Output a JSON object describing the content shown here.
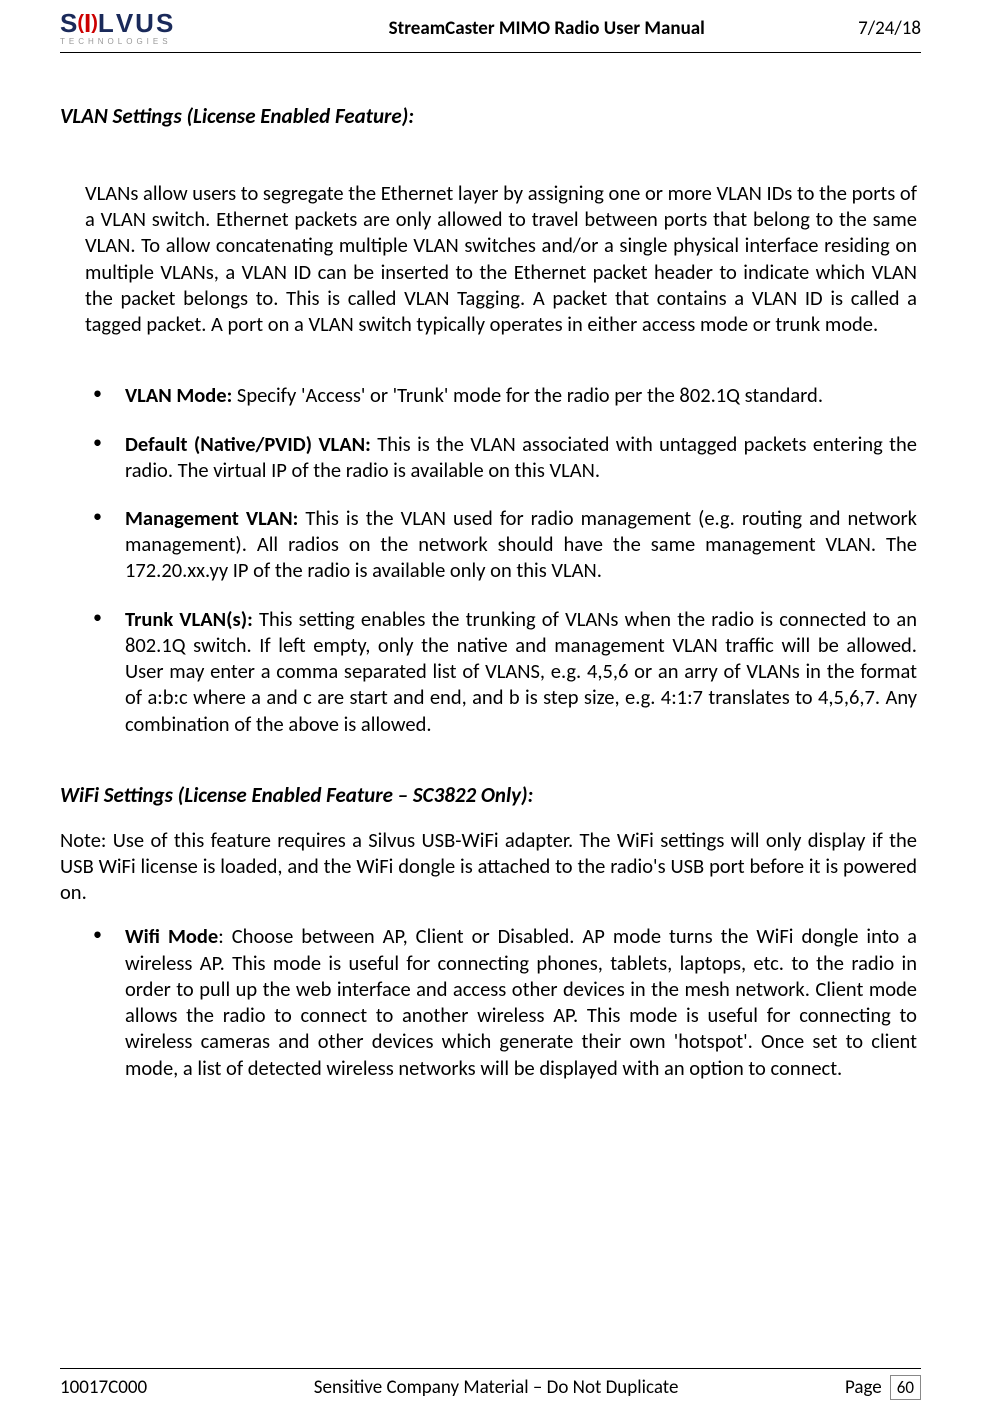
{
  "header": {
    "logo_main": "SILVUS",
    "logo_sub": "TECHNOLOGIES",
    "title": "StreamCaster MIMO Radio User Manual",
    "date": "7/24/18"
  },
  "section1": {
    "title": "VLAN Settings (License Enabled Feature):",
    "intro": "VLANs allow users to segregate the Ethernet layer by assigning one or more VLAN IDs to the ports of a VLAN switch. Ethernet packets are only allowed to travel between ports that belong to the same VLAN. To allow concatenating multiple VLAN switches and/or a single physical interface residing on multiple VLANs, a VLAN ID can be inserted to the Ethernet packet header to indicate which VLAN the packet belongs to. This is called VLAN Tagging. A packet that contains a VLAN ID is called a tagged packet. A port on a VLAN switch typically operates in either access mode or trunk mode.",
    "bullets": [
      {
        "label": "VLAN Mode: ",
        "text": "Specify 'Access' or 'Trunk' mode for the radio per the 802.1Q standard."
      },
      {
        "label": "Default (Native/PVID) VLAN: ",
        "text": "This is the VLAN associated with untagged packets entering the radio. The virtual IP of the radio is available on this VLAN."
      },
      {
        "label": "Management VLAN: ",
        "text": "This is the VLAN used for radio management (e.g. routing and network management). All radios on the network should have the same management VLAN. The 172.20.xx.yy IP of the radio is available only on this VLAN."
      },
      {
        "label": "Trunk VLAN(s): ",
        "text": "This setting enables the trunking of VLANs when the radio is connected to an 802.1Q switch. If left empty, only the native and management VLAN traffic will be allowed. User may enter a comma separated list of VLANS, e.g. 4,5,6 or an arry of VLANs in the format of a:b:c where a and c are start and end, and b is step size, e.g. 4:1:7 translates to 4,5,6,7. Any combination of the above is allowed."
      }
    ]
  },
  "section2": {
    "title": "WiFi Settings (License Enabled Feature – SC3822 Only):",
    "note": "Note: Use of this feature requires a Silvus USB-WiFi adapter. The WiFi settings will only display if the USB WiFi license is loaded, and the WiFi dongle is attached to the radio's USB port before it is powered on.",
    "bullets": [
      {
        "label": "Wifi Mode",
        "text": ": Choose between AP, Client or Disabled. AP mode turns the WiFi dongle into a wireless AP. This mode is useful for connecting phones, tablets, laptops, etc. to the radio in order to pull up the web interface and access other devices in the mesh network. Client mode allows the radio to connect to another wireless AP. This mode is useful for connecting to wireless cameras and other devices which generate their own 'hotspot'. Once set to client mode, a list of detected wireless networks will be displayed with an option to connect."
      }
    ]
  },
  "footer": {
    "left": "10017C000",
    "center": "Sensitive Company Material – Do Not Duplicate",
    "page_label": "Page",
    "page_num": "60"
  }
}
